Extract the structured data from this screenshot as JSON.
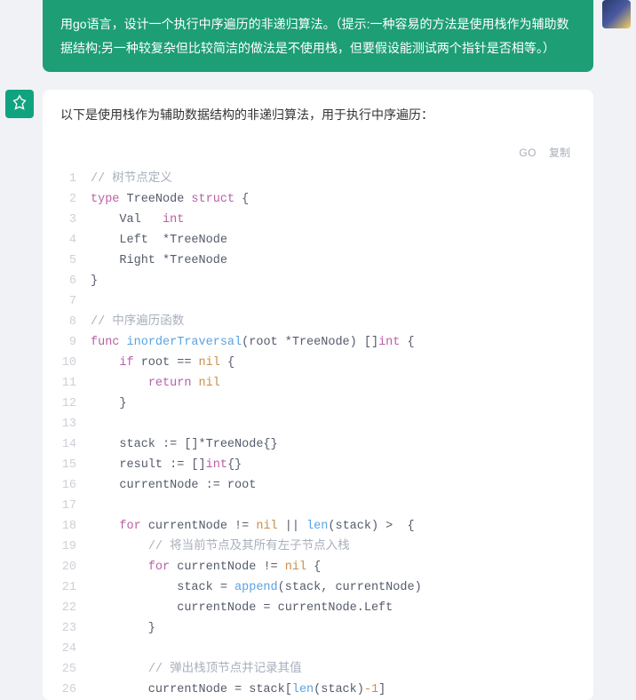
{
  "user_message": "用go语言，设计一个执行中序遍历的非递归算法。（提示:一种容易的方法是使用栈作为辅助数据结构;另一种较复杂但比较简洁的做法是不使用栈，但要假设能测试两个指针是否相等。）",
  "assistant_intro": "以下是使用栈作为辅助数据结构的非递归算法，用于执行中序遍历：",
  "code_header": {
    "language": "GO",
    "copy_label": "复制"
  },
  "code_lines": [
    [
      {
        "t": "// 树节点定义",
        "c": "cm"
      }
    ],
    [
      {
        "t": "type",
        "c": "kw"
      },
      {
        "t": " TreeNode ",
        "c": "id"
      },
      {
        "t": "struct",
        "c": "kw"
      },
      {
        "t": " {",
        "c": "pn"
      }
    ],
    [
      {
        "t": "    Val   ",
        "c": "id"
      },
      {
        "t": "int",
        "c": "ty"
      }
    ],
    [
      {
        "t": "    Left  *TreeNode",
        "c": "id"
      }
    ],
    [
      {
        "t": "    Right *TreeNode",
        "c": "id"
      }
    ],
    [
      {
        "t": "}",
        "c": "pn"
      }
    ],
    [],
    [
      {
        "t": "// 中序遍历函数",
        "c": "cm"
      }
    ],
    [
      {
        "t": "func",
        "c": "kw"
      },
      {
        "t": " ",
        "c": "id"
      },
      {
        "t": "inorderTraversal",
        "c": "fn"
      },
      {
        "t": "(root *TreeNode)",
        "c": "id"
      },
      {
        "t": " []",
        "c": "pn"
      },
      {
        "t": "int",
        "c": "ty"
      },
      {
        "t": " {",
        "c": "pn"
      }
    ],
    [
      {
        "t": "    ",
        "c": "id"
      },
      {
        "t": "if",
        "c": "kw"
      },
      {
        "t": " root == ",
        "c": "id"
      },
      {
        "t": "nil",
        "c": "bl"
      },
      {
        "t": " {",
        "c": "pn"
      }
    ],
    [
      {
        "t": "        ",
        "c": "id"
      },
      {
        "t": "return",
        "c": "kw"
      },
      {
        "t": " ",
        "c": "id"
      },
      {
        "t": "nil",
        "c": "bl"
      }
    ],
    [
      {
        "t": "    }",
        "c": "pn"
      }
    ],
    [],
    [
      {
        "t": "    stack := []*TreeNode{}",
        "c": "id"
      }
    ],
    [
      {
        "t": "    result := []",
        "c": "id"
      },
      {
        "t": "int",
        "c": "ty"
      },
      {
        "t": "{}",
        "c": "pn"
      }
    ],
    [
      {
        "t": "    currentNode := root",
        "c": "id"
      }
    ],
    [],
    [
      {
        "t": "    ",
        "c": "id"
      },
      {
        "t": "for",
        "c": "kw"
      },
      {
        "t": " currentNode != ",
        "c": "id"
      },
      {
        "t": "nil",
        "c": "bl"
      },
      {
        "t": " || ",
        "c": "id"
      },
      {
        "t": "len",
        "c": "fn"
      },
      {
        "t": "(stack) > ",
        "c": "id"
      },
      {
        "t": " {",
        "c": "pn"
      }
    ],
    [
      {
        "t": "        ",
        "c": "id"
      },
      {
        "t": "// 将当前节点及其所有左子节点入栈",
        "c": "cm"
      }
    ],
    [
      {
        "t": "        ",
        "c": "id"
      },
      {
        "t": "for",
        "c": "kw"
      },
      {
        "t": " currentNode != ",
        "c": "id"
      },
      {
        "t": "nil",
        "c": "bl"
      },
      {
        "t": " {",
        "c": "pn"
      }
    ],
    [
      {
        "t": "            stack = ",
        "c": "id"
      },
      {
        "t": "append",
        "c": "fn"
      },
      {
        "t": "(stack, currentNode)",
        "c": "id"
      }
    ],
    [
      {
        "t": "            currentNode = currentNode.Left",
        "c": "id"
      }
    ],
    [
      {
        "t": "        }",
        "c": "pn"
      }
    ],
    [],
    [
      {
        "t": "        ",
        "c": "id"
      },
      {
        "t": "// 弹出栈顶节点并记录其值",
        "c": "cm"
      }
    ],
    [
      {
        "t": "        currentNode = stack[",
        "c": "id"
      },
      {
        "t": "len",
        "c": "fn"
      },
      {
        "t": "(stack)",
        "c": "id"
      },
      {
        "t": "-1",
        "c": "nu"
      },
      {
        "t": "]",
        "c": "id"
      }
    ]
  ]
}
